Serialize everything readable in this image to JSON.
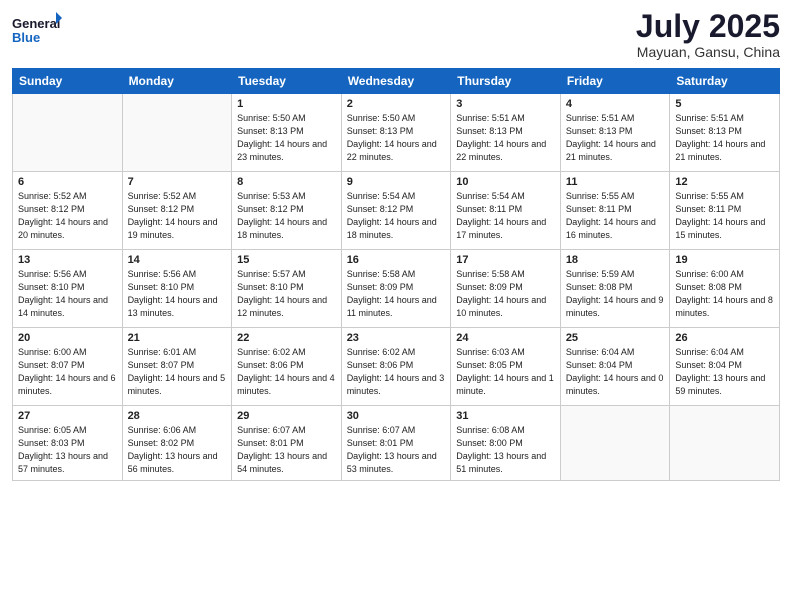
{
  "header": {
    "logo_general": "General",
    "logo_blue": "Blue",
    "month_title": "July 2025",
    "location": "Mayuan, Gansu, China"
  },
  "days_of_week": [
    "Sunday",
    "Monday",
    "Tuesday",
    "Wednesday",
    "Thursday",
    "Friday",
    "Saturday"
  ],
  "weeks": [
    [
      {
        "day": "",
        "info": ""
      },
      {
        "day": "",
        "info": ""
      },
      {
        "day": "1",
        "info": "Sunrise: 5:50 AM\nSunset: 8:13 PM\nDaylight: 14 hours and 23 minutes."
      },
      {
        "day": "2",
        "info": "Sunrise: 5:50 AM\nSunset: 8:13 PM\nDaylight: 14 hours and 22 minutes."
      },
      {
        "day": "3",
        "info": "Sunrise: 5:51 AM\nSunset: 8:13 PM\nDaylight: 14 hours and 22 minutes."
      },
      {
        "day": "4",
        "info": "Sunrise: 5:51 AM\nSunset: 8:13 PM\nDaylight: 14 hours and 21 minutes."
      },
      {
        "day": "5",
        "info": "Sunrise: 5:51 AM\nSunset: 8:13 PM\nDaylight: 14 hours and 21 minutes."
      }
    ],
    [
      {
        "day": "6",
        "info": "Sunrise: 5:52 AM\nSunset: 8:12 PM\nDaylight: 14 hours and 20 minutes."
      },
      {
        "day": "7",
        "info": "Sunrise: 5:52 AM\nSunset: 8:12 PM\nDaylight: 14 hours and 19 minutes."
      },
      {
        "day": "8",
        "info": "Sunrise: 5:53 AM\nSunset: 8:12 PM\nDaylight: 14 hours and 18 minutes."
      },
      {
        "day": "9",
        "info": "Sunrise: 5:54 AM\nSunset: 8:12 PM\nDaylight: 14 hours and 18 minutes."
      },
      {
        "day": "10",
        "info": "Sunrise: 5:54 AM\nSunset: 8:11 PM\nDaylight: 14 hours and 17 minutes."
      },
      {
        "day": "11",
        "info": "Sunrise: 5:55 AM\nSunset: 8:11 PM\nDaylight: 14 hours and 16 minutes."
      },
      {
        "day": "12",
        "info": "Sunrise: 5:55 AM\nSunset: 8:11 PM\nDaylight: 14 hours and 15 minutes."
      }
    ],
    [
      {
        "day": "13",
        "info": "Sunrise: 5:56 AM\nSunset: 8:10 PM\nDaylight: 14 hours and 14 minutes."
      },
      {
        "day": "14",
        "info": "Sunrise: 5:56 AM\nSunset: 8:10 PM\nDaylight: 14 hours and 13 minutes."
      },
      {
        "day": "15",
        "info": "Sunrise: 5:57 AM\nSunset: 8:10 PM\nDaylight: 14 hours and 12 minutes."
      },
      {
        "day": "16",
        "info": "Sunrise: 5:58 AM\nSunset: 8:09 PM\nDaylight: 14 hours and 11 minutes."
      },
      {
        "day": "17",
        "info": "Sunrise: 5:58 AM\nSunset: 8:09 PM\nDaylight: 14 hours and 10 minutes."
      },
      {
        "day": "18",
        "info": "Sunrise: 5:59 AM\nSunset: 8:08 PM\nDaylight: 14 hours and 9 minutes."
      },
      {
        "day": "19",
        "info": "Sunrise: 6:00 AM\nSunset: 8:08 PM\nDaylight: 14 hours and 8 minutes."
      }
    ],
    [
      {
        "day": "20",
        "info": "Sunrise: 6:00 AM\nSunset: 8:07 PM\nDaylight: 14 hours and 6 minutes."
      },
      {
        "day": "21",
        "info": "Sunrise: 6:01 AM\nSunset: 8:07 PM\nDaylight: 14 hours and 5 minutes."
      },
      {
        "day": "22",
        "info": "Sunrise: 6:02 AM\nSunset: 8:06 PM\nDaylight: 14 hours and 4 minutes."
      },
      {
        "day": "23",
        "info": "Sunrise: 6:02 AM\nSunset: 8:06 PM\nDaylight: 14 hours and 3 minutes."
      },
      {
        "day": "24",
        "info": "Sunrise: 6:03 AM\nSunset: 8:05 PM\nDaylight: 14 hours and 1 minute."
      },
      {
        "day": "25",
        "info": "Sunrise: 6:04 AM\nSunset: 8:04 PM\nDaylight: 14 hours and 0 minutes."
      },
      {
        "day": "26",
        "info": "Sunrise: 6:04 AM\nSunset: 8:04 PM\nDaylight: 13 hours and 59 minutes."
      }
    ],
    [
      {
        "day": "27",
        "info": "Sunrise: 6:05 AM\nSunset: 8:03 PM\nDaylight: 13 hours and 57 minutes."
      },
      {
        "day": "28",
        "info": "Sunrise: 6:06 AM\nSunset: 8:02 PM\nDaylight: 13 hours and 56 minutes."
      },
      {
        "day": "29",
        "info": "Sunrise: 6:07 AM\nSunset: 8:01 PM\nDaylight: 13 hours and 54 minutes."
      },
      {
        "day": "30",
        "info": "Sunrise: 6:07 AM\nSunset: 8:01 PM\nDaylight: 13 hours and 53 minutes."
      },
      {
        "day": "31",
        "info": "Sunrise: 6:08 AM\nSunset: 8:00 PM\nDaylight: 13 hours and 51 minutes."
      },
      {
        "day": "",
        "info": ""
      },
      {
        "day": "",
        "info": ""
      }
    ]
  ]
}
